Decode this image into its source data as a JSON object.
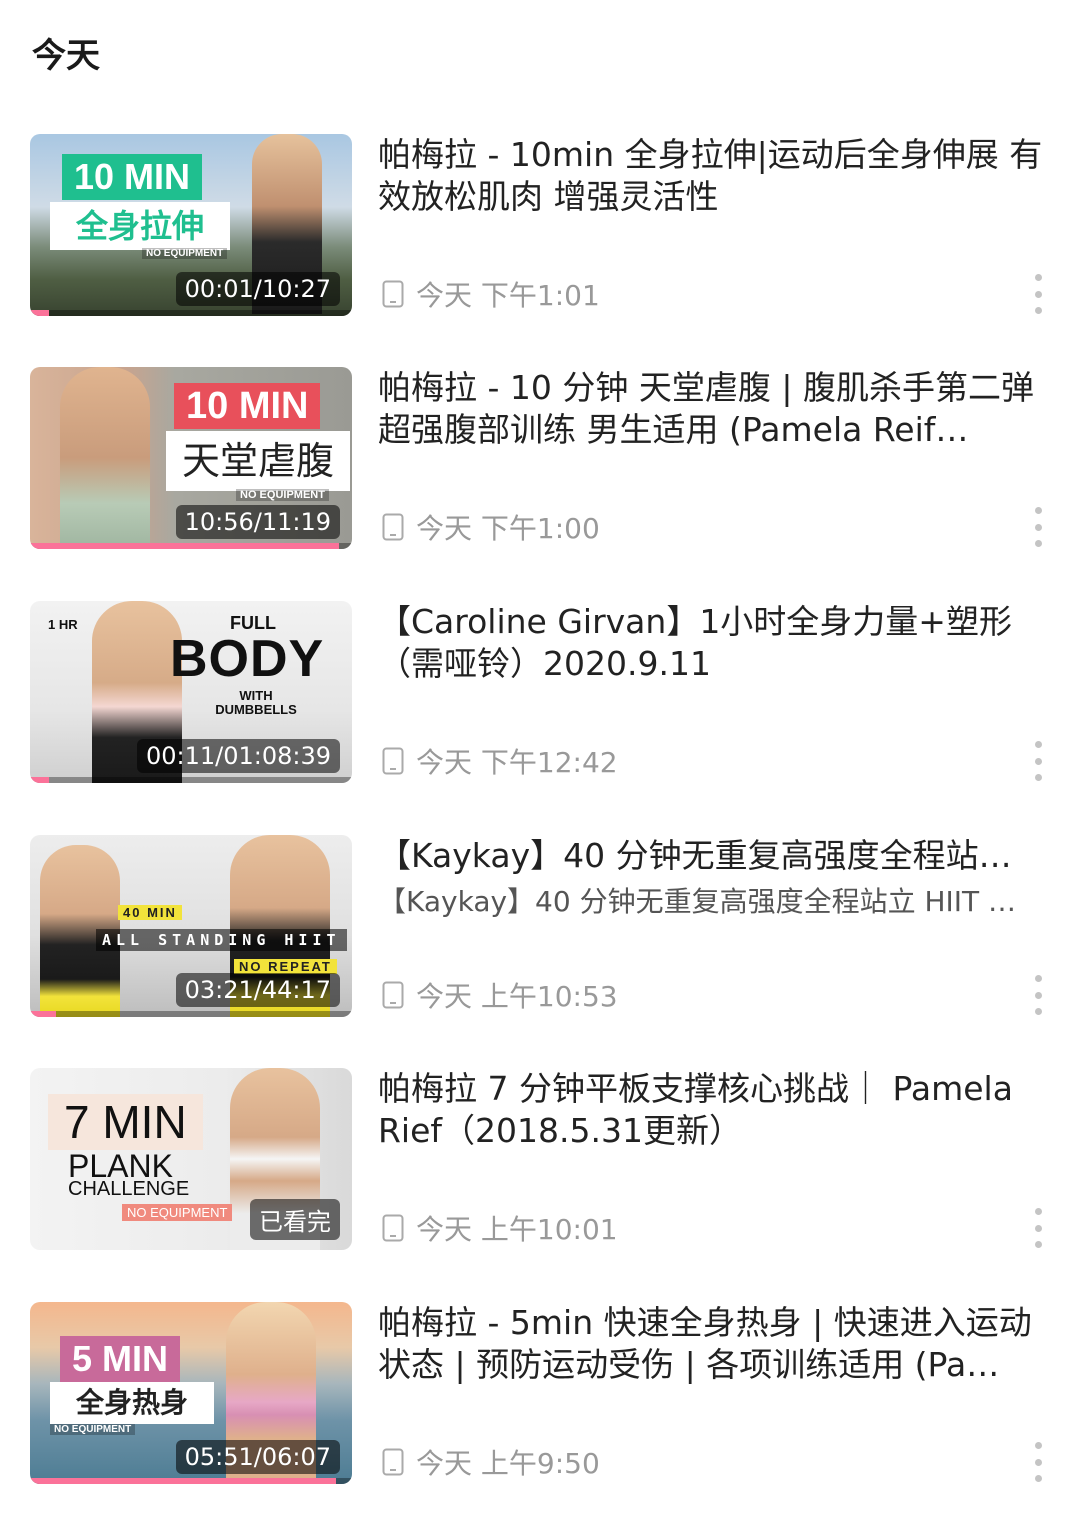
{
  "section": {
    "title": "今天"
  },
  "items": [
    {
      "title": "帕梅拉 - 10min 全身拉伸|运动后全身伸展 有效放松肌肉 增强灵活性",
      "subtitle": "",
      "time": "今天 下午1:01",
      "duration": "00:01/10:27",
      "progress": 0.06,
      "thumb": {
        "line1": "10 MIN",
        "line2": "全身拉伸",
        "line3": "NO EQUIPMENT",
        "accent": "#1fbf8f"
      }
    },
    {
      "title": "帕梅拉 - 10 分钟 天堂虐腹 | 腹肌杀手第二弹 超强腹部训练 男生适用 (Pamela Reif…",
      "subtitle": "",
      "time": "今天 下午1:00",
      "duration": "10:56/11:19",
      "progress": 0.96,
      "thumb": {
        "line1": "10 MIN",
        "line2": "天堂虐腹",
        "line3": "NO EQUIPMENT",
        "accent": "#e8505b"
      }
    },
    {
      "title": "【Caroline Girvan】1小时全身力量+塑形（需哑铃）2020.9.11",
      "subtitle": "",
      "time": "今天 下午12:42",
      "duration": "00:11/01:08:39",
      "progress": 0.06,
      "thumb": {
        "line1": "1 HR",
        "line2": "FULL",
        "line3": "BODY",
        "line4": "WITH DUMBBELLS"
      }
    },
    {
      "title": "【Kaykay】40 分钟无重复高强度全程站…",
      "subtitle": "【Kaykay】40 分钟无重复高强度全程站立 HIIT …",
      "time": "今天 上午10:53",
      "duration": "03:21/44:17",
      "progress": 0.08,
      "thumb": {
        "line1": "40 MIN",
        "line2": "ALL STANDING HIIT",
        "line3": "NO REPEAT"
      }
    },
    {
      "title": "帕梅拉 7 分钟平板支撑核心挑战｜ Pamela Rief（2018.5.31更新）",
      "subtitle": "",
      "time": "今天 上午10:01",
      "duration": "已看完",
      "progress": 0,
      "thumb": {
        "line1": "7 MIN",
        "line2": "PLANK",
        "line3": "CHALLENGE",
        "line4": "NO EQUIPMENT"
      }
    },
    {
      "title": "帕梅拉 - 5min 快速全身热身 | 快速进入运动状态 | 预防运动受伤 | 各项训练适用 (Pa…",
      "subtitle": "",
      "time": "今天 上午9:50",
      "duration": "05:51/06:07",
      "progress": 0.95,
      "thumb": {
        "line1": "5 MIN",
        "line2": "全身热身",
        "line3": "NO EQUIPMENT",
        "accent": "#c86a9a"
      }
    }
  ]
}
